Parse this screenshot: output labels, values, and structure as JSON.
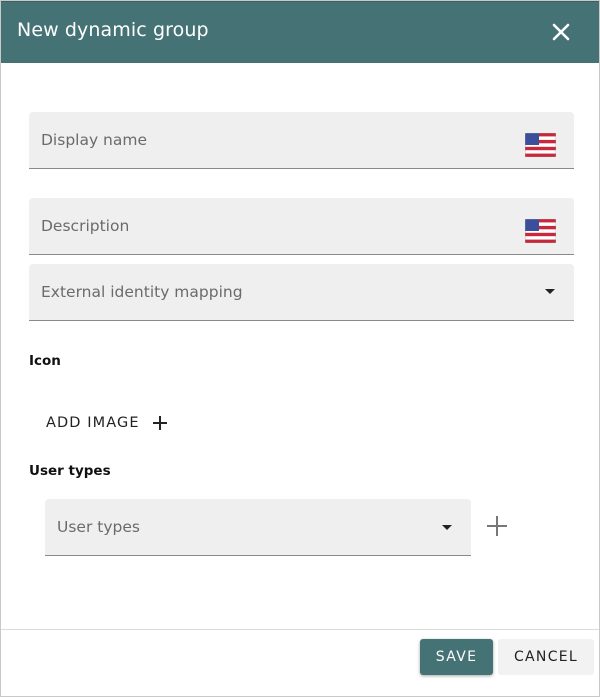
{
  "dialog": {
    "title": "New dynamic group",
    "close_icon": "close-icon"
  },
  "fields": {
    "display_name": {
      "placeholder": "Display name",
      "flag_icon": "us-flag-icon"
    },
    "description": {
      "placeholder": "Description",
      "flag_icon": "us-flag-icon"
    },
    "external_identity_mapping": {
      "placeholder": "External identity mapping",
      "icon": "dropdown-arrow-icon"
    }
  },
  "icon_section": {
    "label": "Icon",
    "add_image_label": "ADD IMAGE",
    "add_icon": "plus-icon"
  },
  "user_types_section": {
    "label": "User types",
    "select_placeholder": "User types",
    "add_icon": "plus-icon"
  },
  "footer": {
    "save_label": "SAVE",
    "cancel_label": "CANCEL"
  },
  "colors": {
    "primary": "#457274",
    "field_bg": "#efefef",
    "cancel_bg": "#f2f2f2"
  }
}
